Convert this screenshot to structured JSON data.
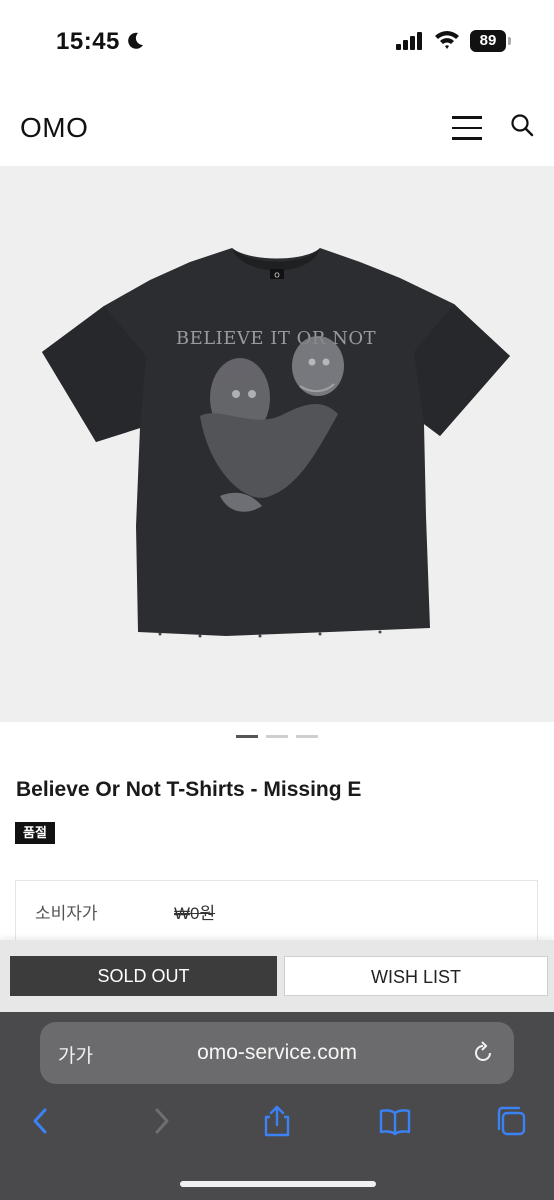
{
  "status_bar": {
    "time": "15:45",
    "battery": "89",
    "icons": [
      "moon-icon",
      "signal-icon",
      "wifi-icon",
      "battery-icon"
    ]
  },
  "header": {
    "logo": "OMO",
    "icons": [
      "hamburger-menu-icon",
      "search-icon"
    ]
  },
  "product": {
    "image_alt": "black t-shirt with graphic print",
    "print_text": "BELIEVE IT OR NOT",
    "collar_label": "O",
    "gallery": {
      "count": 3,
      "active_index": 0
    },
    "title": "Believe Or Not T-Shirts - Missing E",
    "badge": "품절",
    "price_rows": [
      {
        "label": "소비자가",
        "value": "₩0원"
      }
    ]
  },
  "actions": {
    "sold_out_label": "SOLD OUT",
    "wish_list_label": "WISH LIST"
  },
  "browser": {
    "text_size_label": "가가",
    "url": "omo-service.com",
    "toolbar_icons": [
      "back-icon",
      "forward-icon",
      "share-icon",
      "bookmarks-icon",
      "tabs-icon"
    ]
  },
  "colors": {
    "accent_dark": "#3c3c3c",
    "toolbar_blue": "#3b82f6",
    "safari_bg": "#4a4a4c"
  }
}
